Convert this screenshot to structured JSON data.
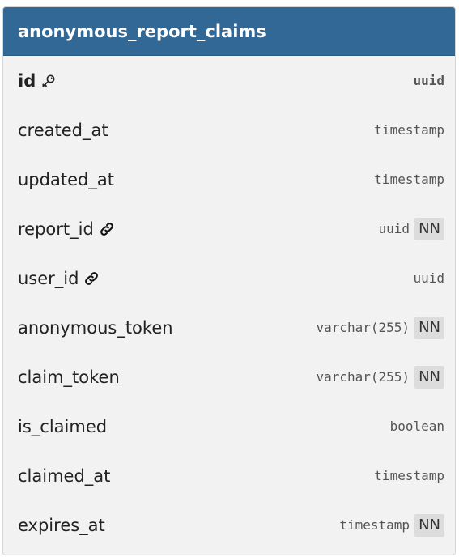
{
  "table": {
    "title": "anonymous_report_claims",
    "columns": [
      {
        "name": "id",
        "type": "uuid",
        "nn_label": "",
        "icon": "key-icon",
        "pk": true
      },
      {
        "name": "created_at",
        "type": "timestamp",
        "nn_label": "",
        "icon": "",
        "pk": false
      },
      {
        "name": "updated_at",
        "type": "timestamp",
        "nn_label": "",
        "icon": "",
        "pk": false
      },
      {
        "name": "report_id",
        "type": "uuid",
        "nn_label": "NN",
        "icon": "link-icon",
        "pk": false
      },
      {
        "name": "user_id",
        "type": "uuid",
        "nn_label": "",
        "icon": "link-icon",
        "pk": false
      },
      {
        "name": "anonymous_token",
        "type": "varchar(255)",
        "nn_label": "NN",
        "icon": "",
        "pk": false
      },
      {
        "name": "claim_token",
        "type": "varchar(255)",
        "nn_label": "NN",
        "icon": "",
        "pk": false
      },
      {
        "name": "is_claimed",
        "type": "boolean",
        "nn_label": "",
        "icon": "",
        "pk": false
      },
      {
        "name": "claimed_at",
        "type": "timestamp",
        "nn_label": "",
        "icon": "",
        "pk": false
      },
      {
        "name": "expires_at",
        "type": "timestamp",
        "nn_label": "NN",
        "icon": "",
        "pk": false
      }
    ]
  },
  "colors": {
    "header_bg": "#316896",
    "card_bg": "#f2f2f2",
    "badge_bg": "#dcdcdc"
  }
}
